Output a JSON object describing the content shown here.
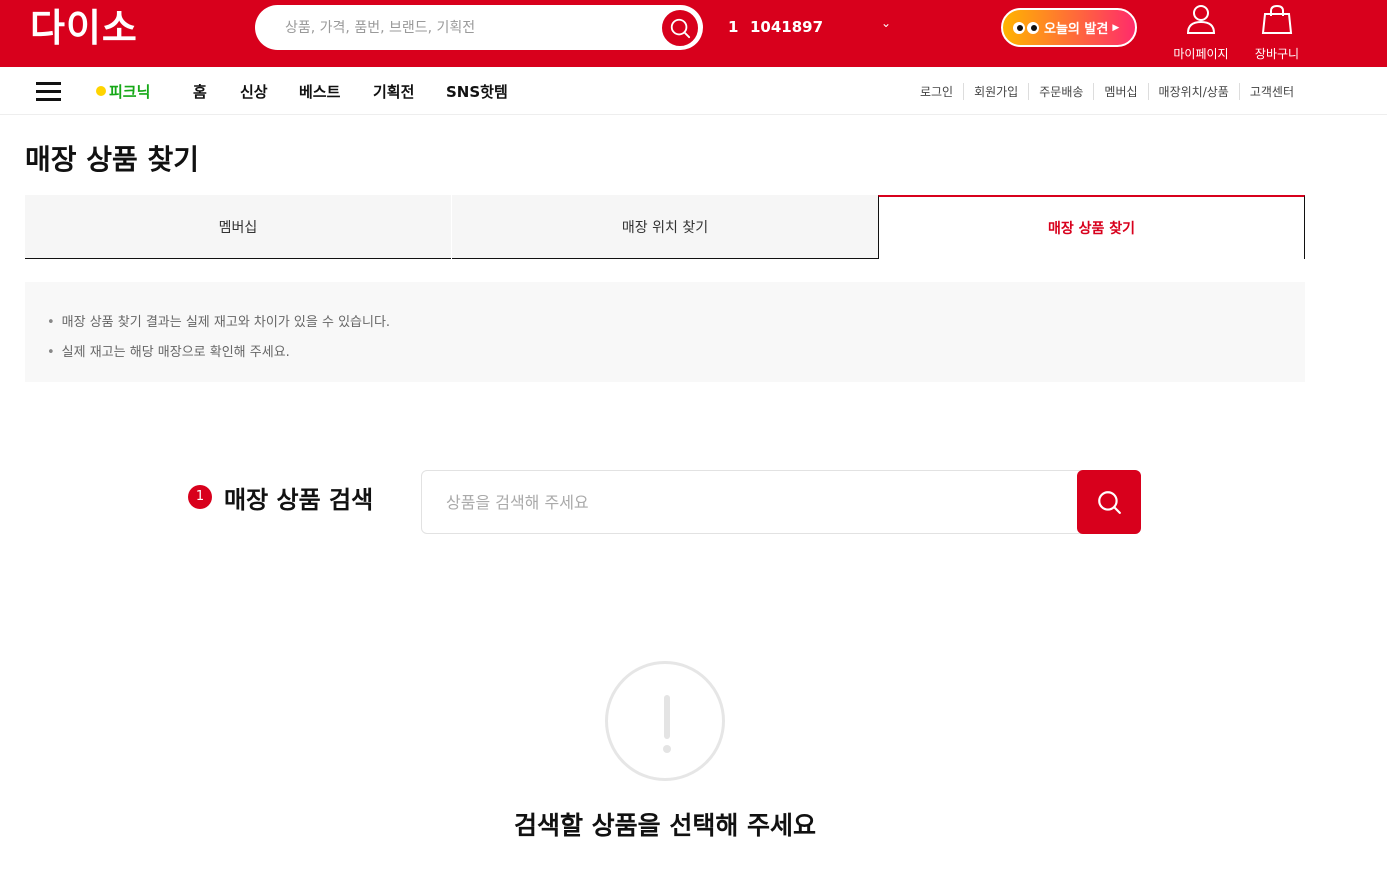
{
  "header": {
    "logo": "다이소",
    "search_placeholder": "상품, 가격, 품번, 브랜드, 기획전",
    "rank_number": "1",
    "rank_keyword": "1041897",
    "discover_label": "오늘의 발견",
    "mypage_label": "마이페이지",
    "cart_label": "장바구니"
  },
  "nav": {
    "picnic_label": "피크닉",
    "items": [
      "홈",
      "신상",
      "베스트",
      "기획전",
      "SNS핫템"
    ],
    "util_links": [
      "로그인",
      "회원가입",
      "주문배송",
      "멤버십",
      "매장위치/상품",
      "고객센터"
    ]
  },
  "page": {
    "title": "매장 상품 찾기",
    "tabs": [
      "멤버십",
      "매장 위치 찾기",
      "매장 상품 찾기"
    ],
    "active_tab": "매장 상품 찾기",
    "notices": [
      "매장 상품 찾기 결과는 실제 재고와 차이가 있을 수 있습니다.",
      "실제 재고는 해당 매장으로 확인해 주세요."
    ]
  },
  "product_search": {
    "step_number": "1",
    "title": "매장 상품 검색",
    "placeholder": "상품을 검색해 주세요"
  },
  "empty_state": {
    "message": "검색할 상품을 선택해 주세요"
  },
  "colors": {
    "brand_red": "#d8001c",
    "picnic_green": "#16a817"
  }
}
